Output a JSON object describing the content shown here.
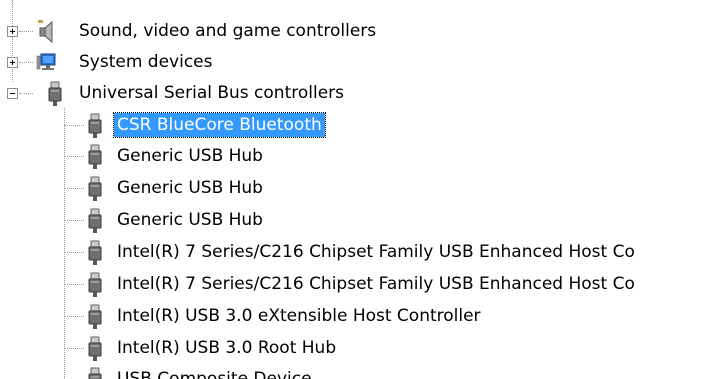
{
  "tree": {
    "categories": [
      {
        "label": "Sound, video and game controllers",
        "icon": "speaker-icon",
        "state": "collapsed"
      },
      {
        "label": "System devices",
        "icon": "computer-icon",
        "state": "collapsed"
      },
      {
        "label": "Universal Serial Bus controllers",
        "icon": "usb-plug-icon",
        "state": "expanded"
      }
    ],
    "usb_devices": [
      {
        "label": "CSR BlueCore Bluetooth",
        "selected": true
      },
      {
        "label": "Generic USB Hub"
      },
      {
        "label": "Generic USB Hub"
      },
      {
        "label": "Generic USB Hub"
      },
      {
        "label": "Intel(R) 7 Series/C216 Chipset Family USB Enhanced Host Co"
      },
      {
        "label": "Intel(R) 7 Series/C216 Chipset Family USB Enhanced Host Co"
      },
      {
        "label": "Intel(R) USB 3.0 eXtensible Host Controller"
      },
      {
        "label": "Intel(R) USB 3.0 Root Hub"
      },
      {
        "label": "USB Composite Device"
      }
    ]
  },
  "colors": {
    "selection": "#3399ff",
    "selection_text": "#ffffff",
    "tree_lines": "#9a9a9a"
  }
}
